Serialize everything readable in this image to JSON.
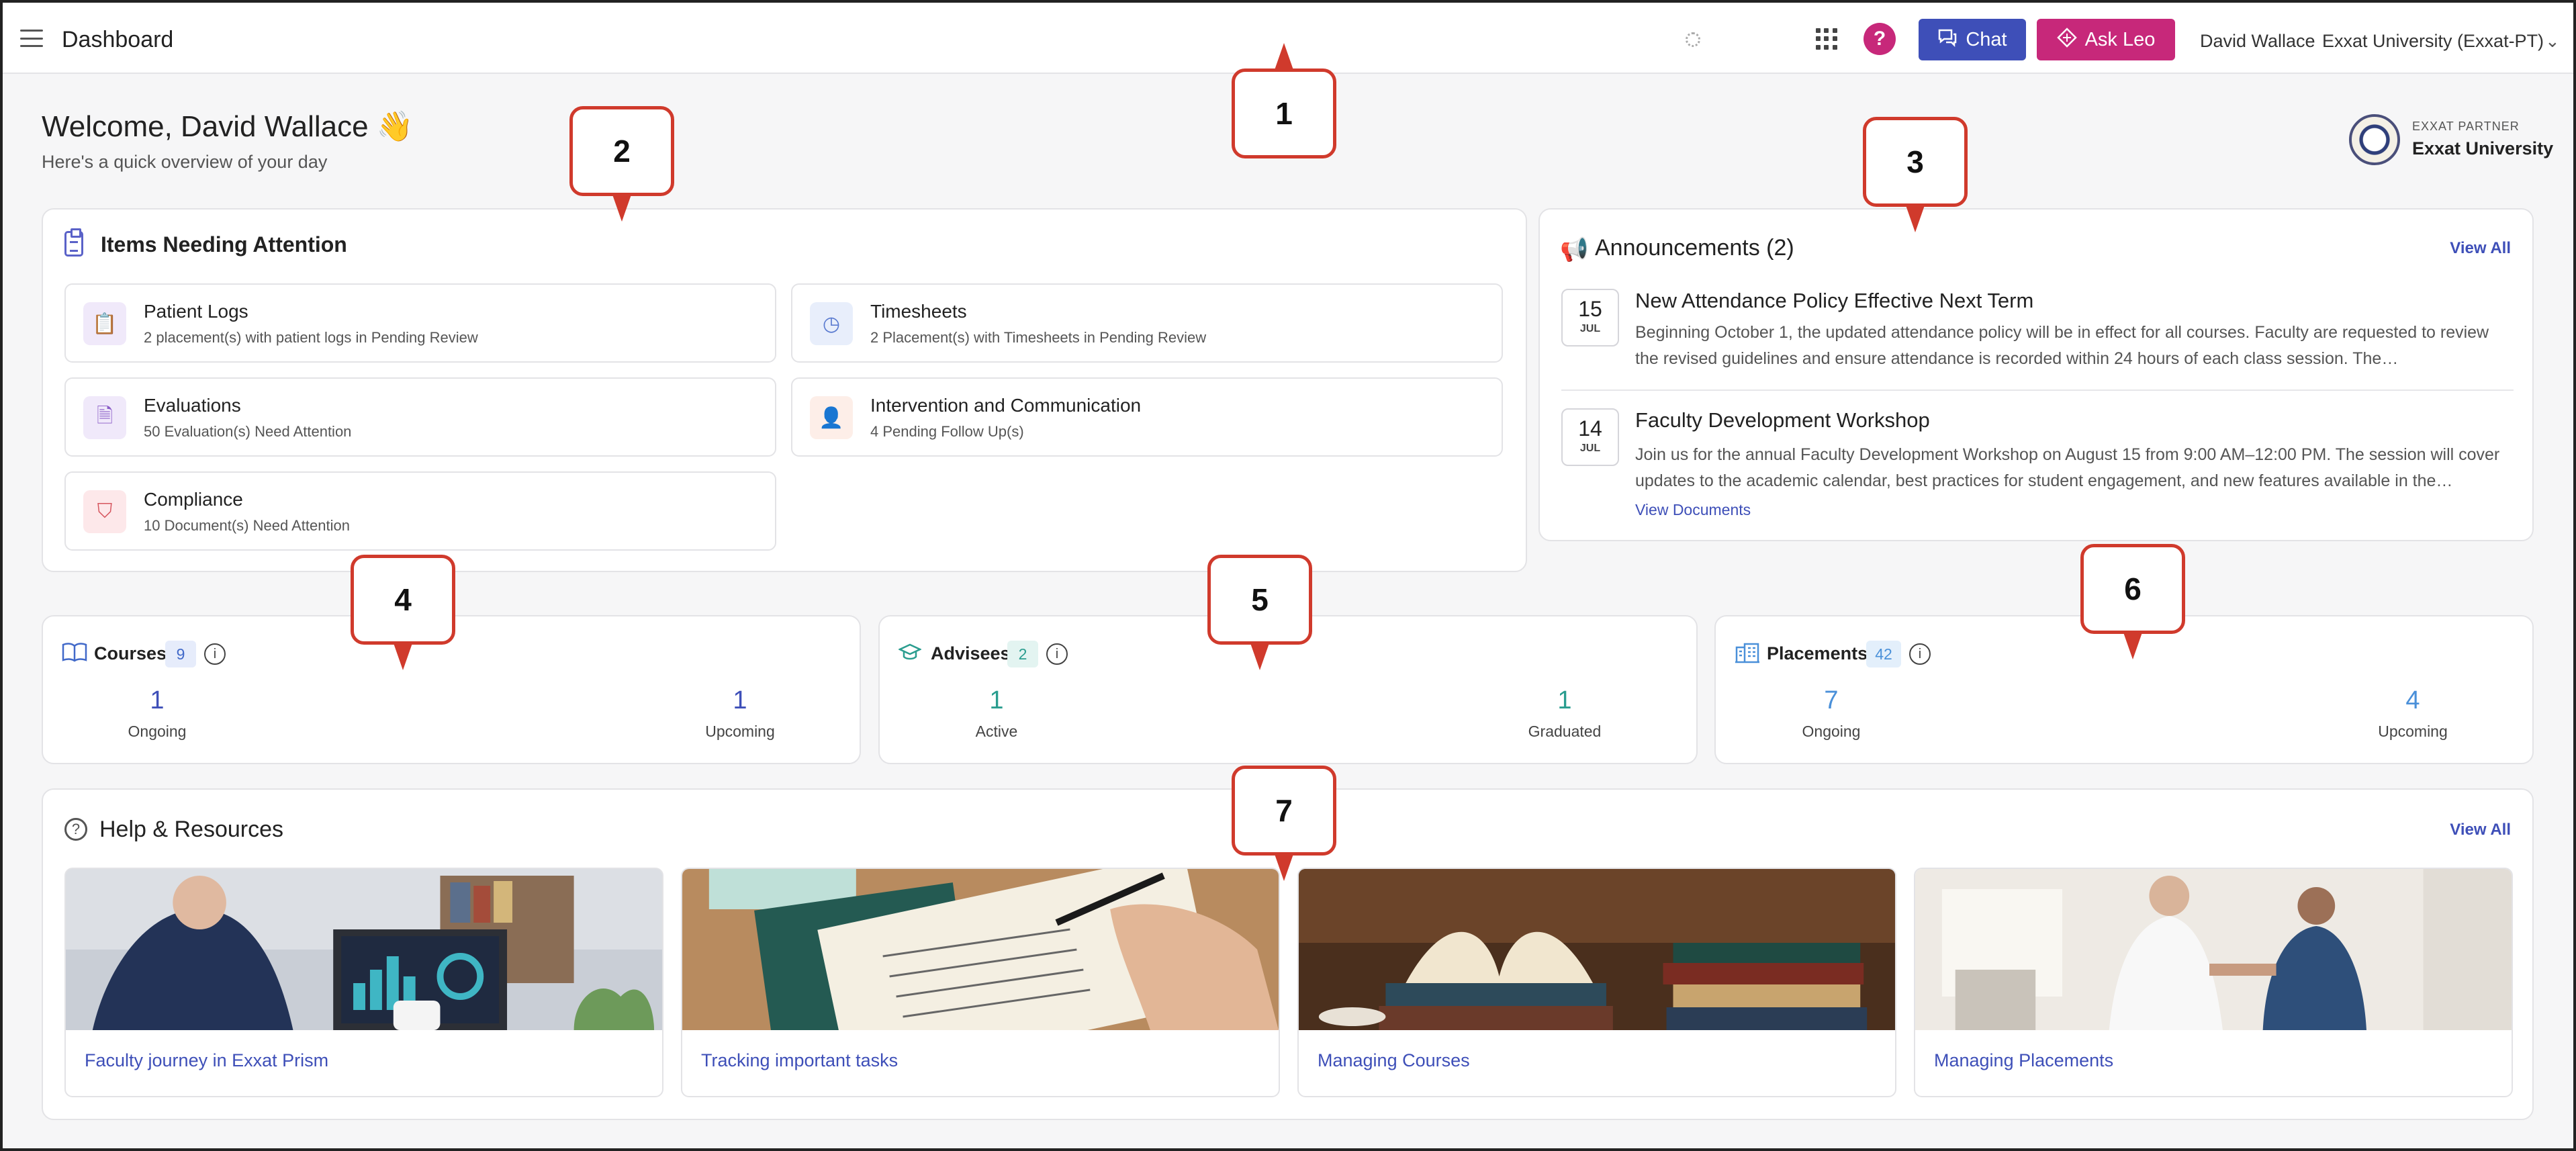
{
  "header": {
    "title": "Dashboard",
    "user_name": "David Wallace",
    "org": "Exxat University (Exxat-PT)",
    "chat_label": "Chat",
    "askleo_label": "Ask Leo"
  },
  "welcome": {
    "title": "Welcome, David Wallace 👋",
    "subtitle": "Here's a quick overview of your day"
  },
  "partner": {
    "label": "EXXAT PARTNER",
    "name": "Exxat University"
  },
  "attention": {
    "title": "Items Needing Attention",
    "items": [
      {
        "title": "Patient Logs",
        "subtitle": "2 placement(s) with patient logs in Pending Review",
        "icon": "clipboard-icon"
      },
      {
        "title": "Timesheets",
        "subtitle": "2 Placement(s) with Timesheets in Pending Review",
        "icon": "clock-icon"
      },
      {
        "title": "Evaluations",
        "subtitle": "50 Evaluation(s) Need Attention",
        "icon": "document-icon"
      },
      {
        "title": "Intervention and Communication",
        "subtitle": "4 Pending Follow Up(s)",
        "icon": "user-plus-icon"
      },
      {
        "title": "Compliance",
        "subtitle": "10 Document(s) Need Attention",
        "icon": "shield-icon"
      }
    ]
  },
  "announcements": {
    "title": "Announcements (2)",
    "view_all": "View All",
    "items": [
      {
        "day": "15",
        "month": "JUL",
        "title": "New Attendance Policy Effective Next Term",
        "body": "Beginning October 1, the updated attendance policy will be in effect for all courses. Faculty are requested to review the revised guidelines and ensure attendance is recorded within 24 hours of each class session. The…"
      },
      {
        "day": "14",
        "month": "JUL",
        "title": "Faculty Development Workshop",
        "body": "Join us for the annual Faculty Development Workshop on August 15 from 9:00 AM–12:00 PM. The session will cover updates to the academic calendar, best practices for student engagement, and new features available in the…",
        "link": "View Documents"
      }
    ]
  },
  "stats": {
    "courses": {
      "title": "Courses",
      "count": "9",
      "left_value": "1",
      "left_label": "Ongoing",
      "right_value": "1",
      "right_label": "Upcoming"
    },
    "advisees": {
      "title": "Advisees",
      "count": "2",
      "left_value": "1",
      "left_label": "Active",
      "right_value": "1",
      "right_label": "Graduated"
    },
    "placements": {
      "title": "Placements",
      "count": "42",
      "left_value": "7",
      "left_label": "Ongoing",
      "right_value": "4",
      "right_label": "Upcoming"
    }
  },
  "help": {
    "title": "Help & Resources",
    "view_all": "View All",
    "items": [
      {
        "label": "Faculty journey in Exxat Prism"
      },
      {
        "label": "Tracking important tasks"
      },
      {
        "label": "Managing Courses"
      },
      {
        "label": "Managing Placements"
      }
    ]
  },
  "callouts": [
    "1",
    "2",
    "3",
    "4",
    "5",
    "6",
    "7"
  ],
  "colors": {
    "brand_blue": "#3e4fb8",
    "brand_pink": "#c7287a",
    "callout_red": "#d03a2c",
    "teal": "#2a9d8f"
  }
}
